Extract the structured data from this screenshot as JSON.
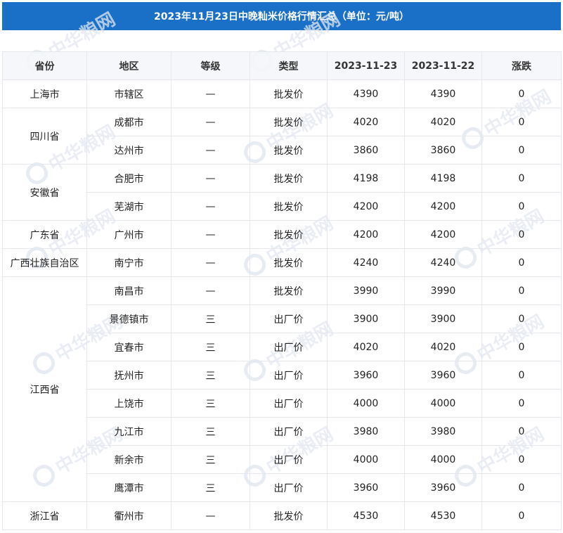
{
  "title": "2023年11月23日中晚籼米价格行情汇总（单位：元/吨）",
  "watermark": {
    "text": "中华粮网",
    "url": "www.cngrain.com",
    "color": "#e3e9f1"
  },
  "accent_color": "#1a6fc7",
  "table": {
    "headers": [
      "省份",
      "地区",
      "等级",
      "类型",
      "2023-11-23",
      "2023-11-22",
      "涨跌"
    ],
    "groups": [
      {
        "province": "上海市",
        "rows": [
          {
            "region": "市辖区",
            "grade": "—",
            "type": "批发价",
            "d1": "4390",
            "d2": "4390",
            "change": "0"
          }
        ]
      },
      {
        "province": "四川省",
        "rows": [
          {
            "region": "成都市",
            "grade": "—",
            "type": "批发价",
            "d1": "4020",
            "d2": "4020",
            "change": "0"
          },
          {
            "region": "达州市",
            "grade": "—",
            "type": "批发价",
            "d1": "3860",
            "d2": "3860",
            "change": "0"
          }
        ]
      },
      {
        "province": "安徽省",
        "rows": [
          {
            "region": "合肥市",
            "grade": "—",
            "type": "批发价",
            "d1": "4198",
            "d2": "4198",
            "change": "0"
          },
          {
            "region": "芜湖市",
            "grade": "—",
            "type": "批发价",
            "d1": "4200",
            "d2": "4200",
            "change": "0"
          }
        ]
      },
      {
        "province": "广东省",
        "rows": [
          {
            "region": "广州市",
            "grade": "—",
            "type": "批发价",
            "d1": "4200",
            "d2": "4200",
            "change": "0"
          }
        ]
      },
      {
        "province": "广西壮族自治区",
        "rows": [
          {
            "region": "南宁市",
            "grade": "—",
            "type": "批发价",
            "d1": "4240",
            "d2": "4240",
            "change": "0"
          }
        ]
      },
      {
        "province": "江西省",
        "rows": [
          {
            "region": "南昌市",
            "grade": "—",
            "type": "批发价",
            "d1": "3990",
            "d2": "3990",
            "change": "0"
          },
          {
            "region": "景德镇市",
            "grade": "三",
            "type": "出厂价",
            "d1": "3900",
            "d2": "3900",
            "change": "0"
          },
          {
            "region": "宜春市",
            "grade": "三",
            "type": "出厂价",
            "d1": "4020",
            "d2": "4020",
            "change": "0"
          },
          {
            "region": "抚州市",
            "grade": "三",
            "type": "出厂价",
            "d1": "3960",
            "d2": "3960",
            "change": "0"
          },
          {
            "region": "上饶市",
            "grade": "三",
            "type": "出厂价",
            "d1": "4000",
            "d2": "4000",
            "change": "0"
          },
          {
            "region": "九江市",
            "grade": "三",
            "type": "出厂价",
            "d1": "3980",
            "d2": "3980",
            "change": "0"
          },
          {
            "region": "新余市",
            "grade": "三",
            "type": "出厂价",
            "d1": "4000",
            "d2": "4000",
            "change": "0"
          },
          {
            "region": "鹰潭市",
            "grade": "三",
            "type": "出厂价",
            "d1": "3960",
            "d2": "3960",
            "change": "0"
          }
        ]
      },
      {
        "province": "浙江省",
        "rows": [
          {
            "region": "衢州市",
            "grade": "—",
            "type": "批发价",
            "d1": "4530",
            "d2": "4530",
            "change": "0"
          }
        ]
      }
    ]
  }
}
